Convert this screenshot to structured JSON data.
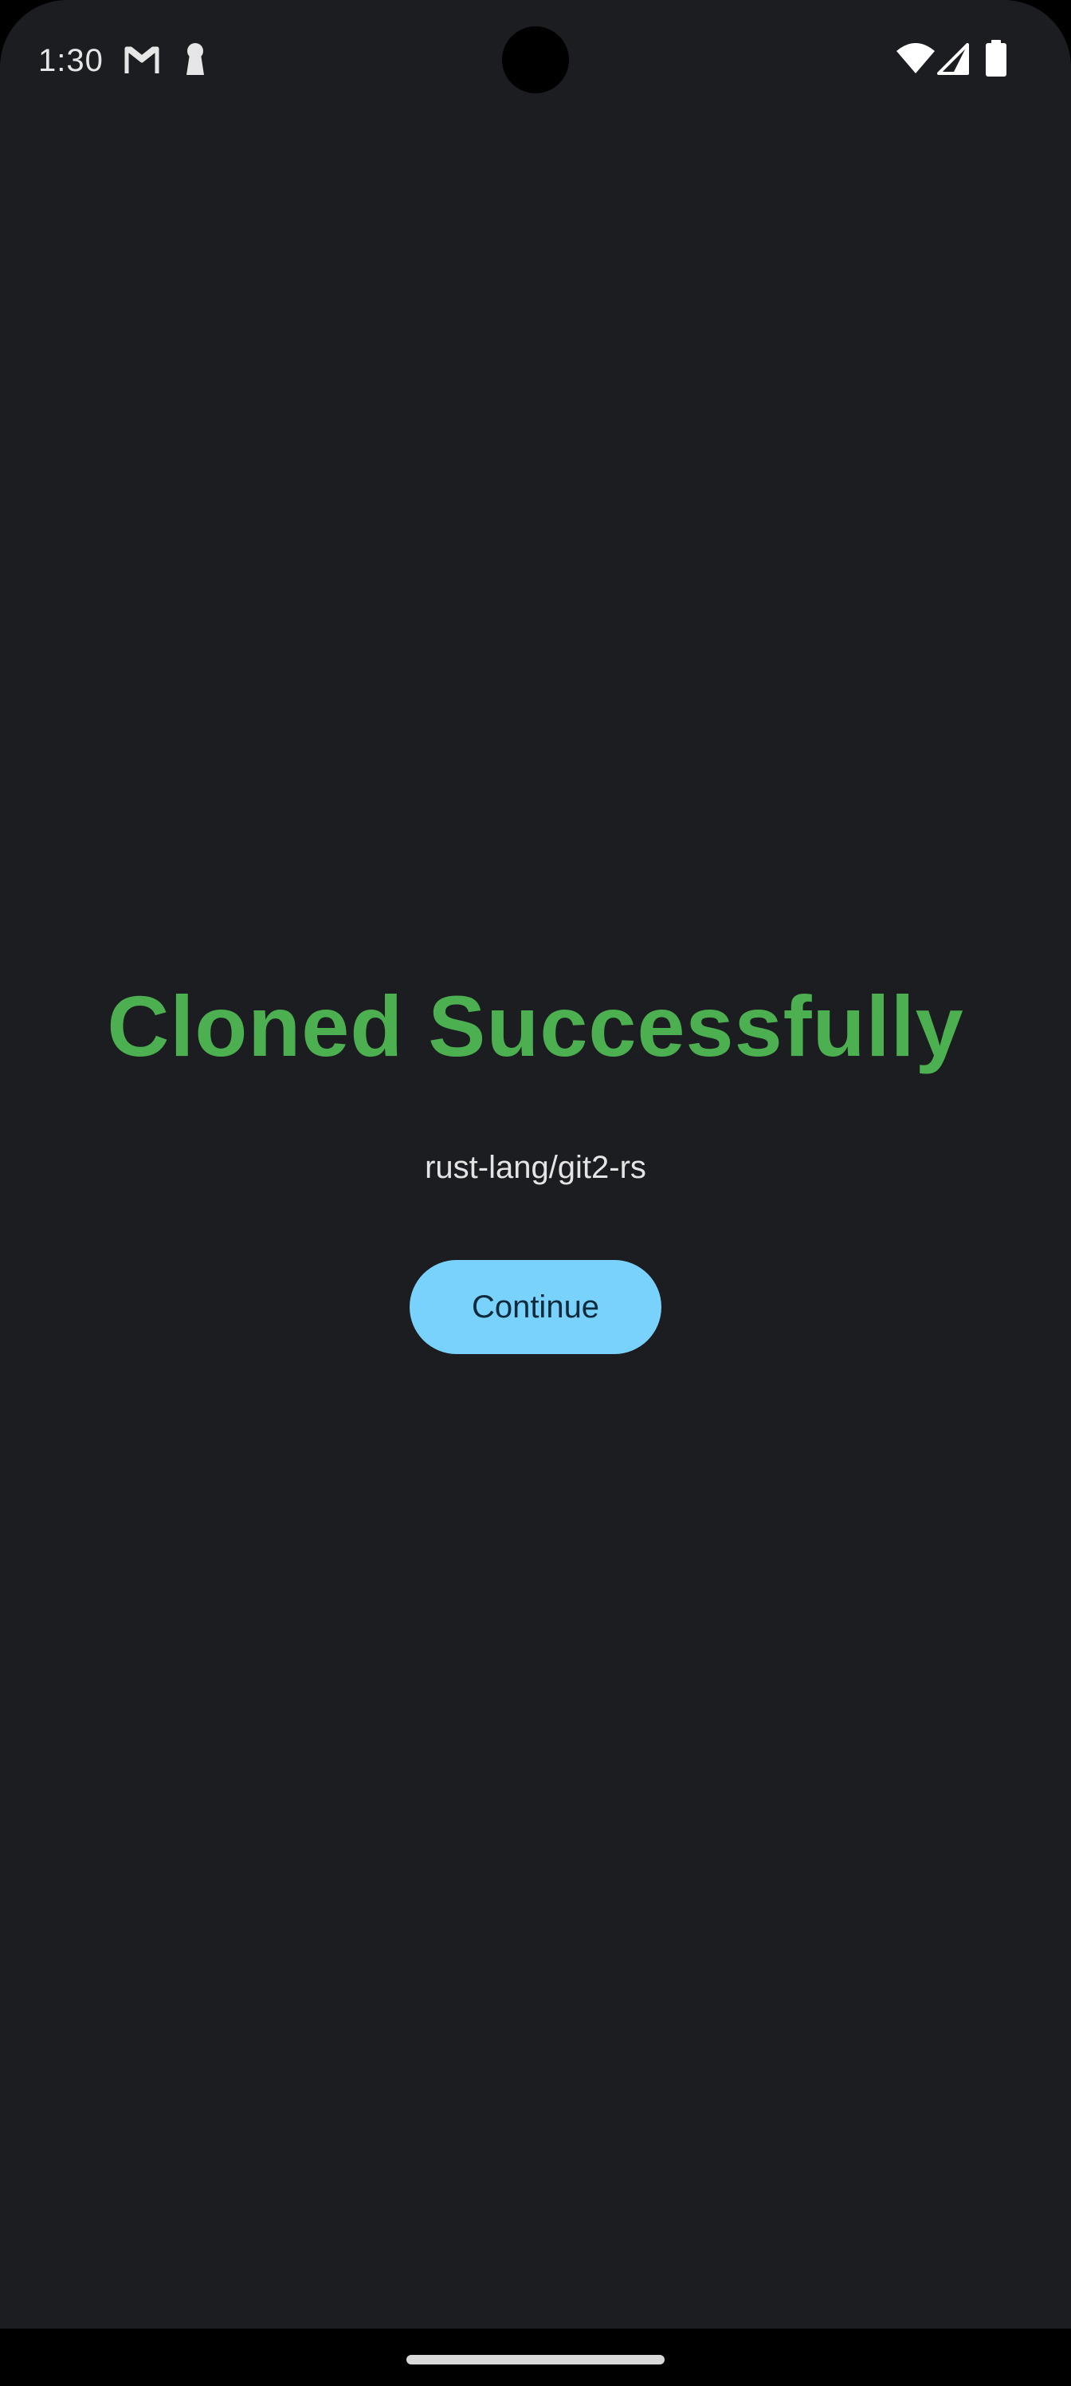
{
  "status_bar": {
    "time": "1:30",
    "icons": [
      "gmail-icon",
      "keyhole-icon",
      "wifi-icon",
      "cellular-signal-icon",
      "battery-icon"
    ]
  },
  "main": {
    "title": "Cloned Successfully",
    "repo": "rust-lang/git2-rs",
    "continue_label": "Continue"
  },
  "colors": {
    "background": "#1b1d20",
    "title": "#4caf50",
    "button": "#78d2fb",
    "button_text": "#0f2a3a",
    "text": "#e4e4e4"
  }
}
